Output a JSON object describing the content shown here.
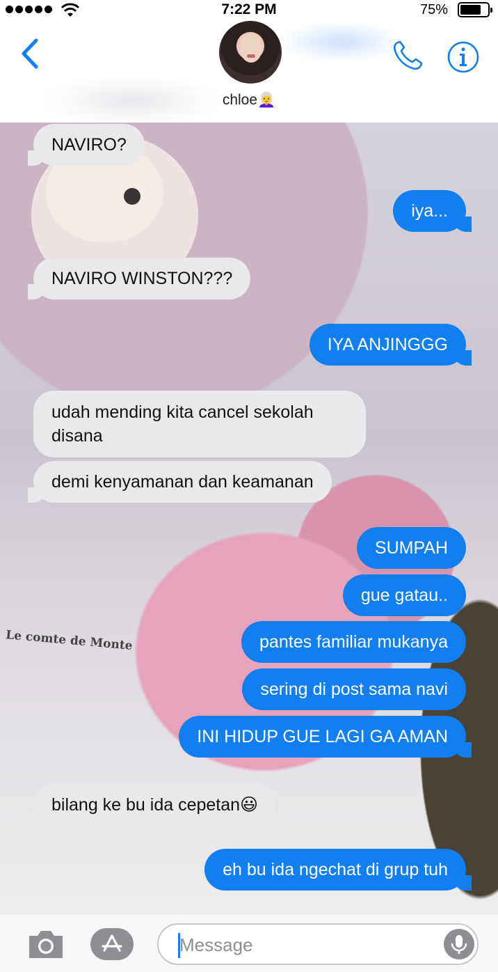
{
  "status_bar": {
    "time": "7:22 PM",
    "battery_percent": "75%",
    "battery_level": 0.75
  },
  "header": {
    "contact_name": "chloe👩‍🦳",
    "back_icon": "chevron-left-icon",
    "call_icon": "phone-icon",
    "info_icon": "info-icon"
  },
  "chat_background": {
    "book_text": "Le comte de Monte"
  },
  "messages": [
    {
      "direction": "in",
      "text": "NAVIRO?"
    },
    {
      "direction": "out",
      "text": "iya..."
    },
    {
      "direction": "in",
      "text": "NAVIRO WINSTON???"
    },
    {
      "direction": "out",
      "text": "IYA ANJINGGG"
    },
    {
      "direction": "in",
      "text": "udah mending kita cancel sekolah disana"
    },
    {
      "direction": "in",
      "text": "demi kenyamanan dan keamanan"
    },
    {
      "direction": "out",
      "text": "SUMPAH"
    },
    {
      "direction": "out",
      "text": "gue gatau.."
    },
    {
      "direction": "out",
      "text": "pantes familiar mukanya"
    },
    {
      "direction": "out",
      "text": "sering di post sama navi"
    },
    {
      "direction": "out",
      "text": "INI HIDUP GUE LAGI GA AMAN"
    },
    {
      "direction": "in",
      "text": "bilang ke bu ida cepetan😃"
    },
    {
      "direction": "out",
      "text": "eh bu ida ngechat di grup tuh"
    }
  ],
  "input_bar": {
    "placeholder": "Message",
    "camera_icon": "camera-icon",
    "apps_icon": "app-store-icon",
    "mic_icon": "microphone-icon"
  },
  "colors": {
    "accent": "#127ff0",
    "incoming_bubble": "#e9e9eb",
    "outgoing_bubble": "#127ff0"
  }
}
